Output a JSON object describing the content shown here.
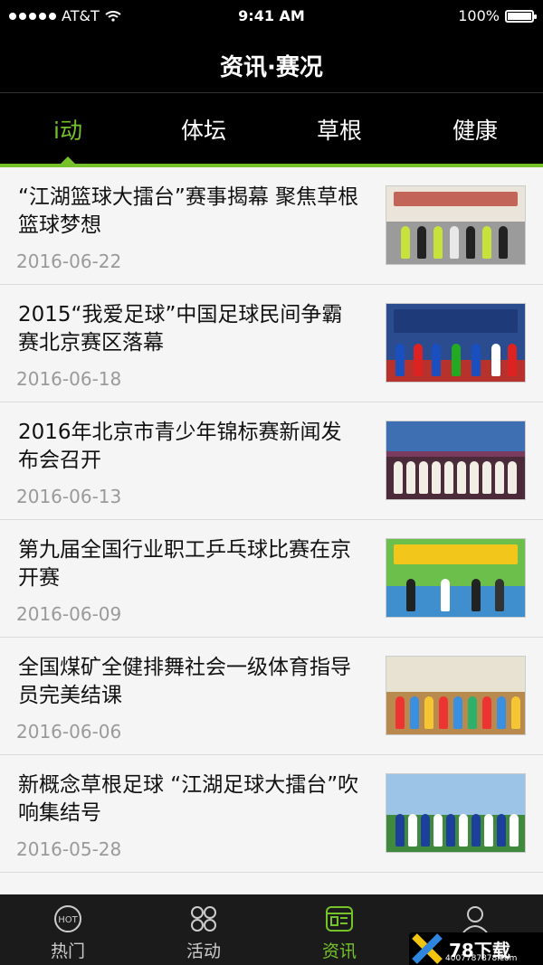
{
  "statusbar": {
    "carrier": "AT&T",
    "time": "9:41 AM",
    "battery": "100%"
  },
  "navbar": {
    "title": "资讯·赛况"
  },
  "tabs": [
    {
      "label": "i动",
      "active": true
    },
    {
      "label": "体坛",
      "active": false
    },
    {
      "label": "草根",
      "active": false
    },
    {
      "label": "健康",
      "active": false
    }
  ],
  "news": [
    {
      "title": "“江湖篮球大擂台”赛事揭幕 聚焦草根篮球梦想",
      "date": "2016-06-22"
    },
    {
      "title": "2015“我爱足球”中国足球民间争霸赛北京赛区落幕",
      "date": "2016-06-18"
    },
    {
      "title": "2016年北京市青少年锦标赛新闻发布会召开",
      "date": "2016-06-13"
    },
    {
      "title": "第九届全国行业职工乒乓球比赛在京开赛",
      "date": "2016-06-09"
    },
    {
      "title": "全国煤矿全健排舞社会一级体育指导员完美结课",
      "date": "2016-06-06"
    },
    {
      "title": "新概念草根足球 “江湖足球大擂台”吹响集结号",
      "date": "2016-05-28"
    }
  ],
  "bottombar": [
    {
      "label": "热门",
      "icon": "hot-icon",
      "active": false
    },
    {
      "label": "活动",
      "icon": "grid-icon",
      "active": false
    },
    {
      "label": "资讯",
      "icon": "news-icon",
      "active": true
    },
    {
      "label": "我的",
      "icon": "profile-icon",
      "active": false
    }
  ],
  "watermark": {
    "brand": "78下载",
    "site": "4007787878.com"
  },
  "colors": {
    "accent": "#76c22a",
    "header": "#000000",
    "background": "#f5f5f5"
  }
}
